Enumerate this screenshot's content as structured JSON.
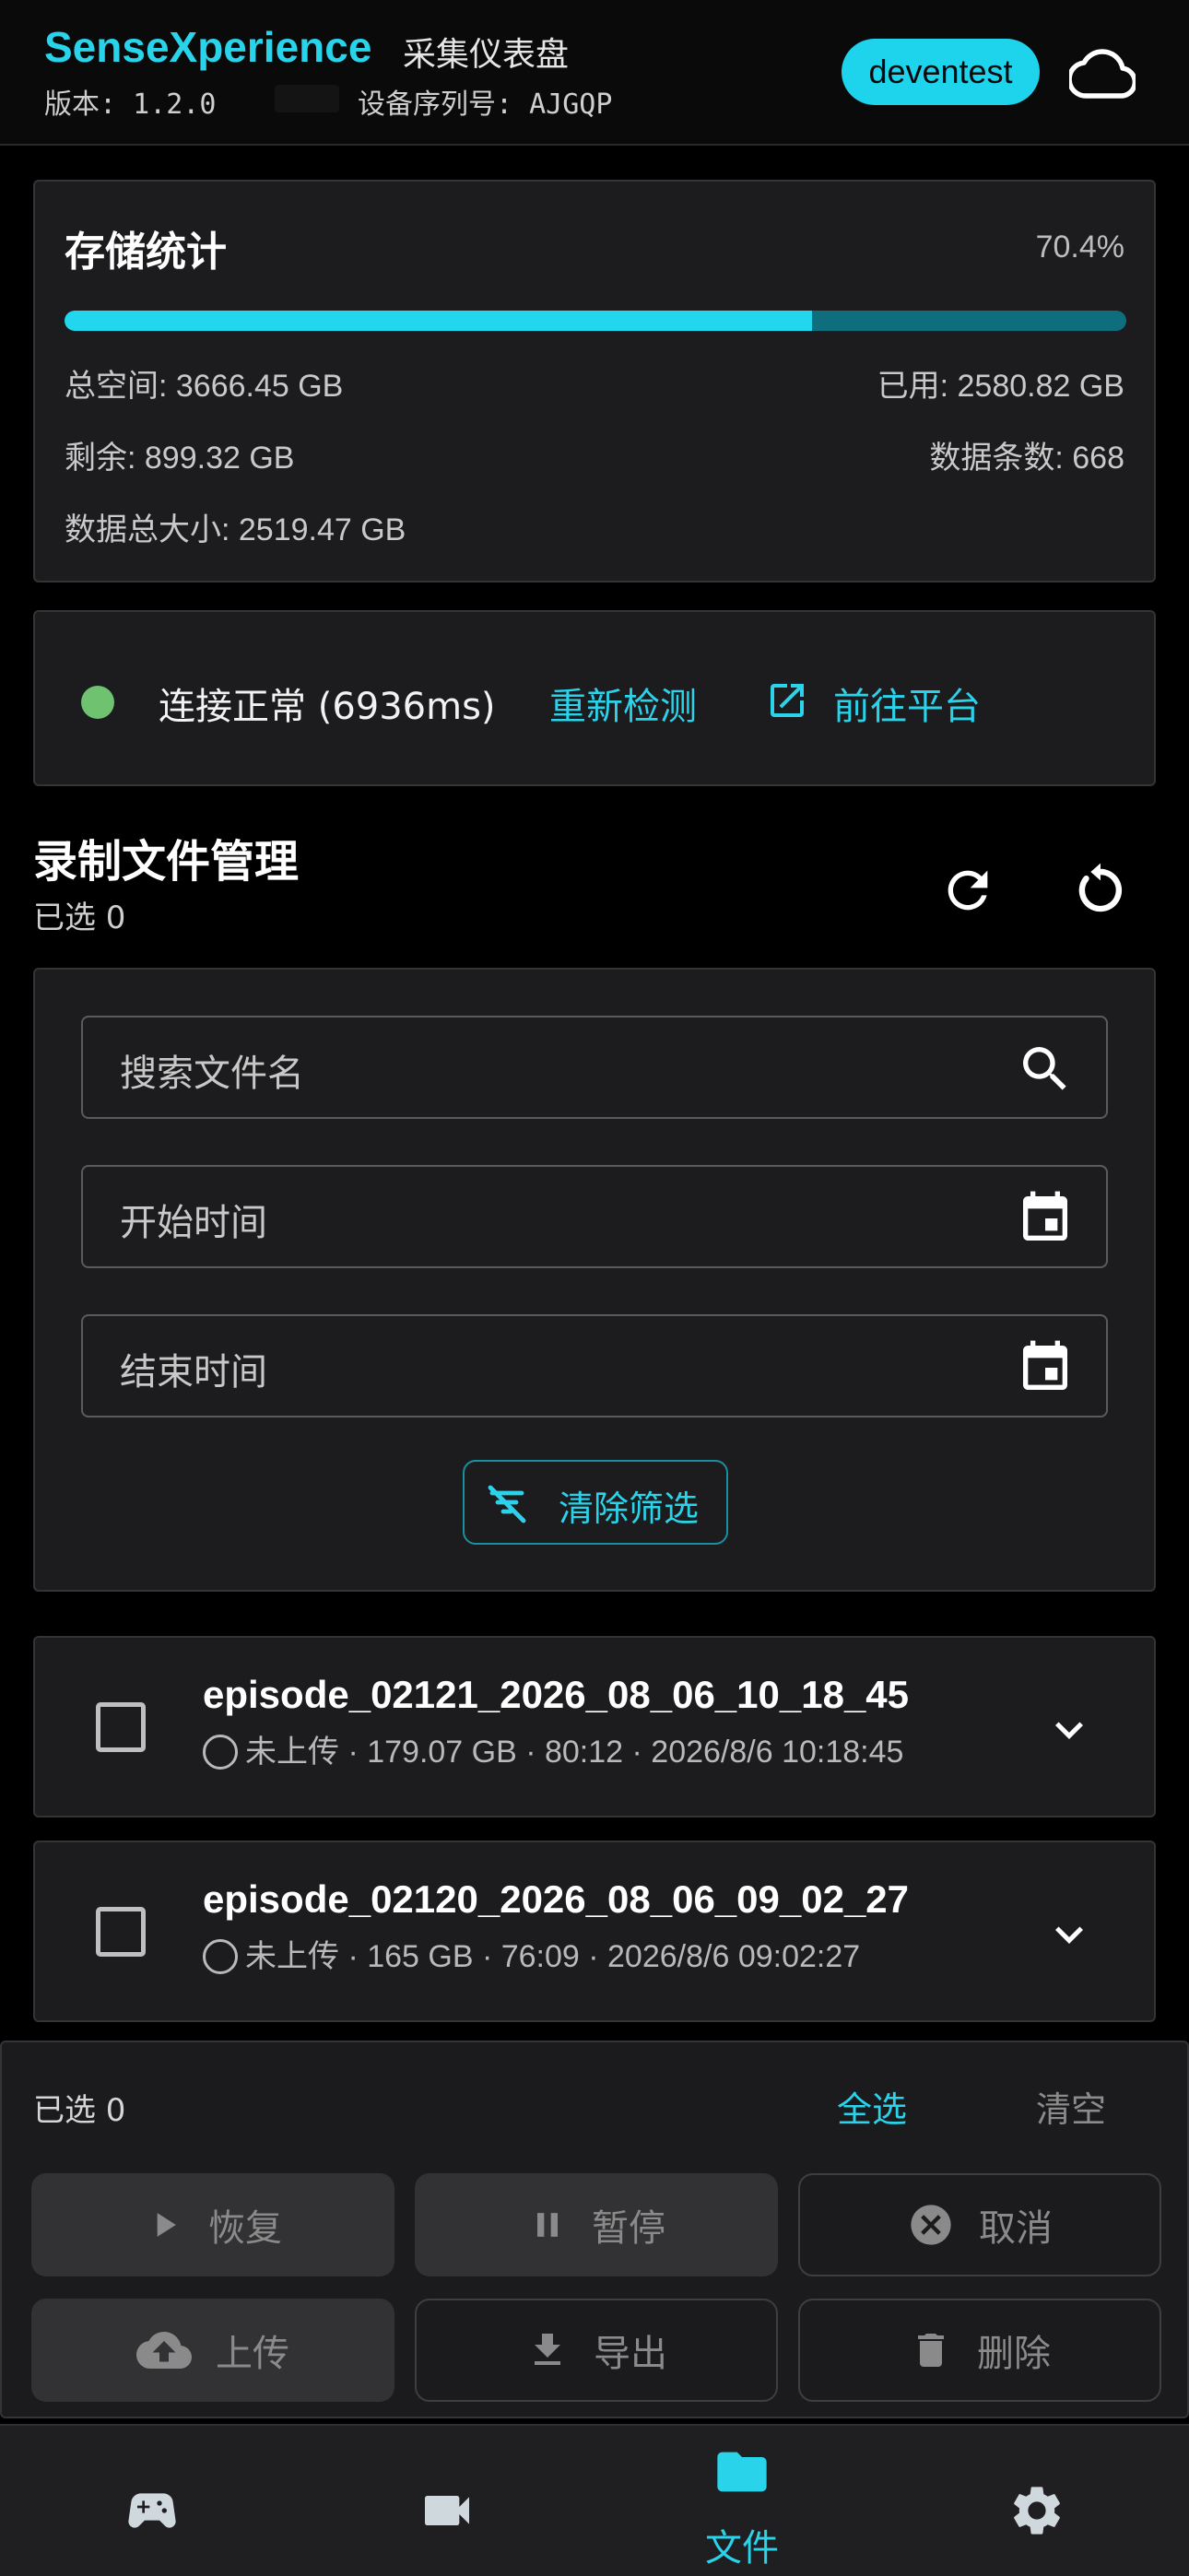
{
  "header": {
    "brand": "SenseXperience",
    "subtitle": "采集仪表盘",
    "version": "版本: 1.2.0",
    "serial": "设备序列号: AJGQP",
    "user": "deventest",
    "cloud_icon": "cloud-icon"
  },
  "storage": {
    "title": "存储统计",
    "percent_label": "70.4%",
    "used_fraction": 0.704,
    "total": "总空间: 3666.45 GB",
    "used": "已用: 2580.82 GB",
    "remaining": "剩余: 899.32 GB",
    "count": "数据条数: 668",
    "data_size": "数据总大小: 2519.47 GB",
    "bar_fill_color": "#22d6ee",
    "bar_track_color": "#0f6e7e"
  },
  "connection": {
    "status": "连接正常 (6936ms)",
    "status_color": "#6fc26f",
    "recheck": "重新检测",
    "goto_platform": "前往平台"
  },
  "files": {
    "title": "录制文件管理",
    "selected": "已选 0"
  },
  "filters": {
    "search_placeholder": "搜索文件名",
    "start_placeholder": "开始时间",
    "end_placeholder": "结束时间",
    "clear": "清除筛选"
  },
  "episodes": [
    {
      "name": "episode_02121_2026_08_06_10_18_45",
      "status": "未上传",
      "meta": " · 179.07 GB · 80:12 · 2026/8/6 10:18:45"
    },
    {
      "name": "episode_02120_2026_08_06_09_02_27",
      "status": "未上传",
      "meta": " · 165 GB · 76:09 · 2026/8/6 09:02:27"
    }
  ],
  "actions": {
    "selected": "已选 0",
    "select_all": "全选",
    "clear": "清空",
    "resume": "恢复",
    "pause": "暂停",
    "cancel": "取消",
    "upload": "上传",
    "export": "导出",
    "delete": "删除"
  },
  "nav": {
    "items": [
      "gamepad-icon",
      "video-camera-icon",
      "folder-icon",
      "settings-icon"
    ],
    "active_label": "文件",
    "accent": "#29d3ea"
  }
}
